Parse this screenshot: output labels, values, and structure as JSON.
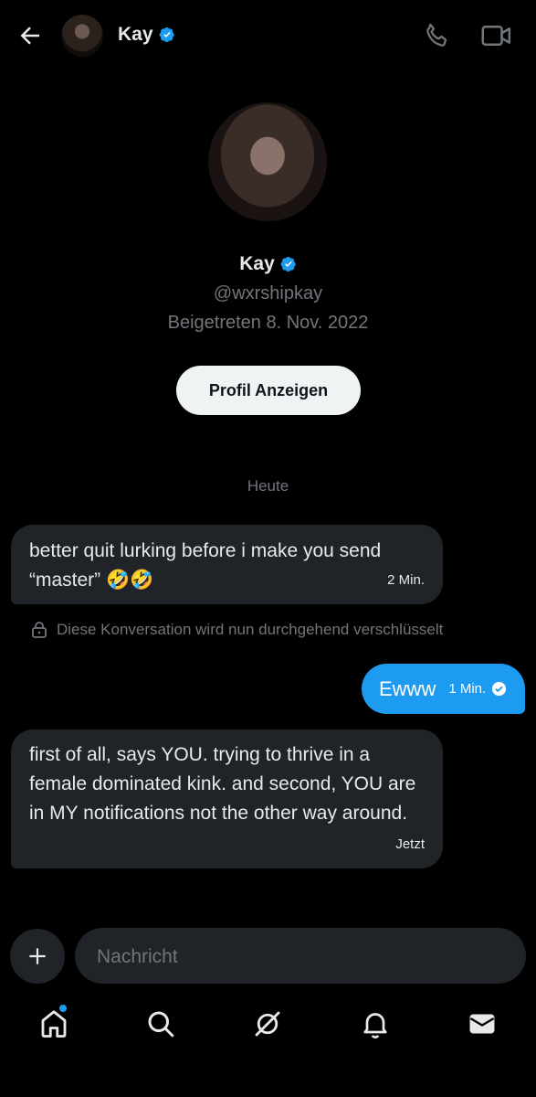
{
  "header": {
    "name": "Kay",
    "icons": {
      "back": "arrow-left-icon",
      "call": "phone-icon",
      "video": "video-camera-icon",
      "verified": "verified-badge-icon"
    }
  },
  "profile": {
    "name": "Kay",
    "handle": "@wxrshipkay",
    "joined": "Beigetreten 8. Nov. 2022",
    "view_button": "Profil Anzeigen"
  },
  "conversation": {
    "date_separator": "Heute",
    "encryption_notice": "Diese Konversation wird nun durchgehend verschlüsselt",
    "messages": [
      {
        "direction": "incoming",
        "text": "better quit lurking before i make you send “master” 🤣🤣",
        "time": "2 Min."
      },
      {
        "direction": "outgoing",
        "text": "Ewww",
        "time": "1 Min.",
        "status": "read"
      },
      {
        "direction": "incoming",
        "text": "first of all, says YOU. trying to thrive in a female dominated kink. and second, YOU are in MY notifications not the other way around.",
        "time": "Jetzt"
      }
    ]
  },
  "composer": {
    "placeholder": "Nachricht"
  },
  "nav": {
    "items": [
      "home-icon",
      "search-icon",
      "grok-icon",
      "bell-icon",
      "mail-icon"
    ],
    "home_has_notification": true
  },
  "colors": {
    "accent": "#1d9bf0",
    "bubble_in": "#202327",
    "background": "#000000",
    "muted": "#71767b"
  }
}
